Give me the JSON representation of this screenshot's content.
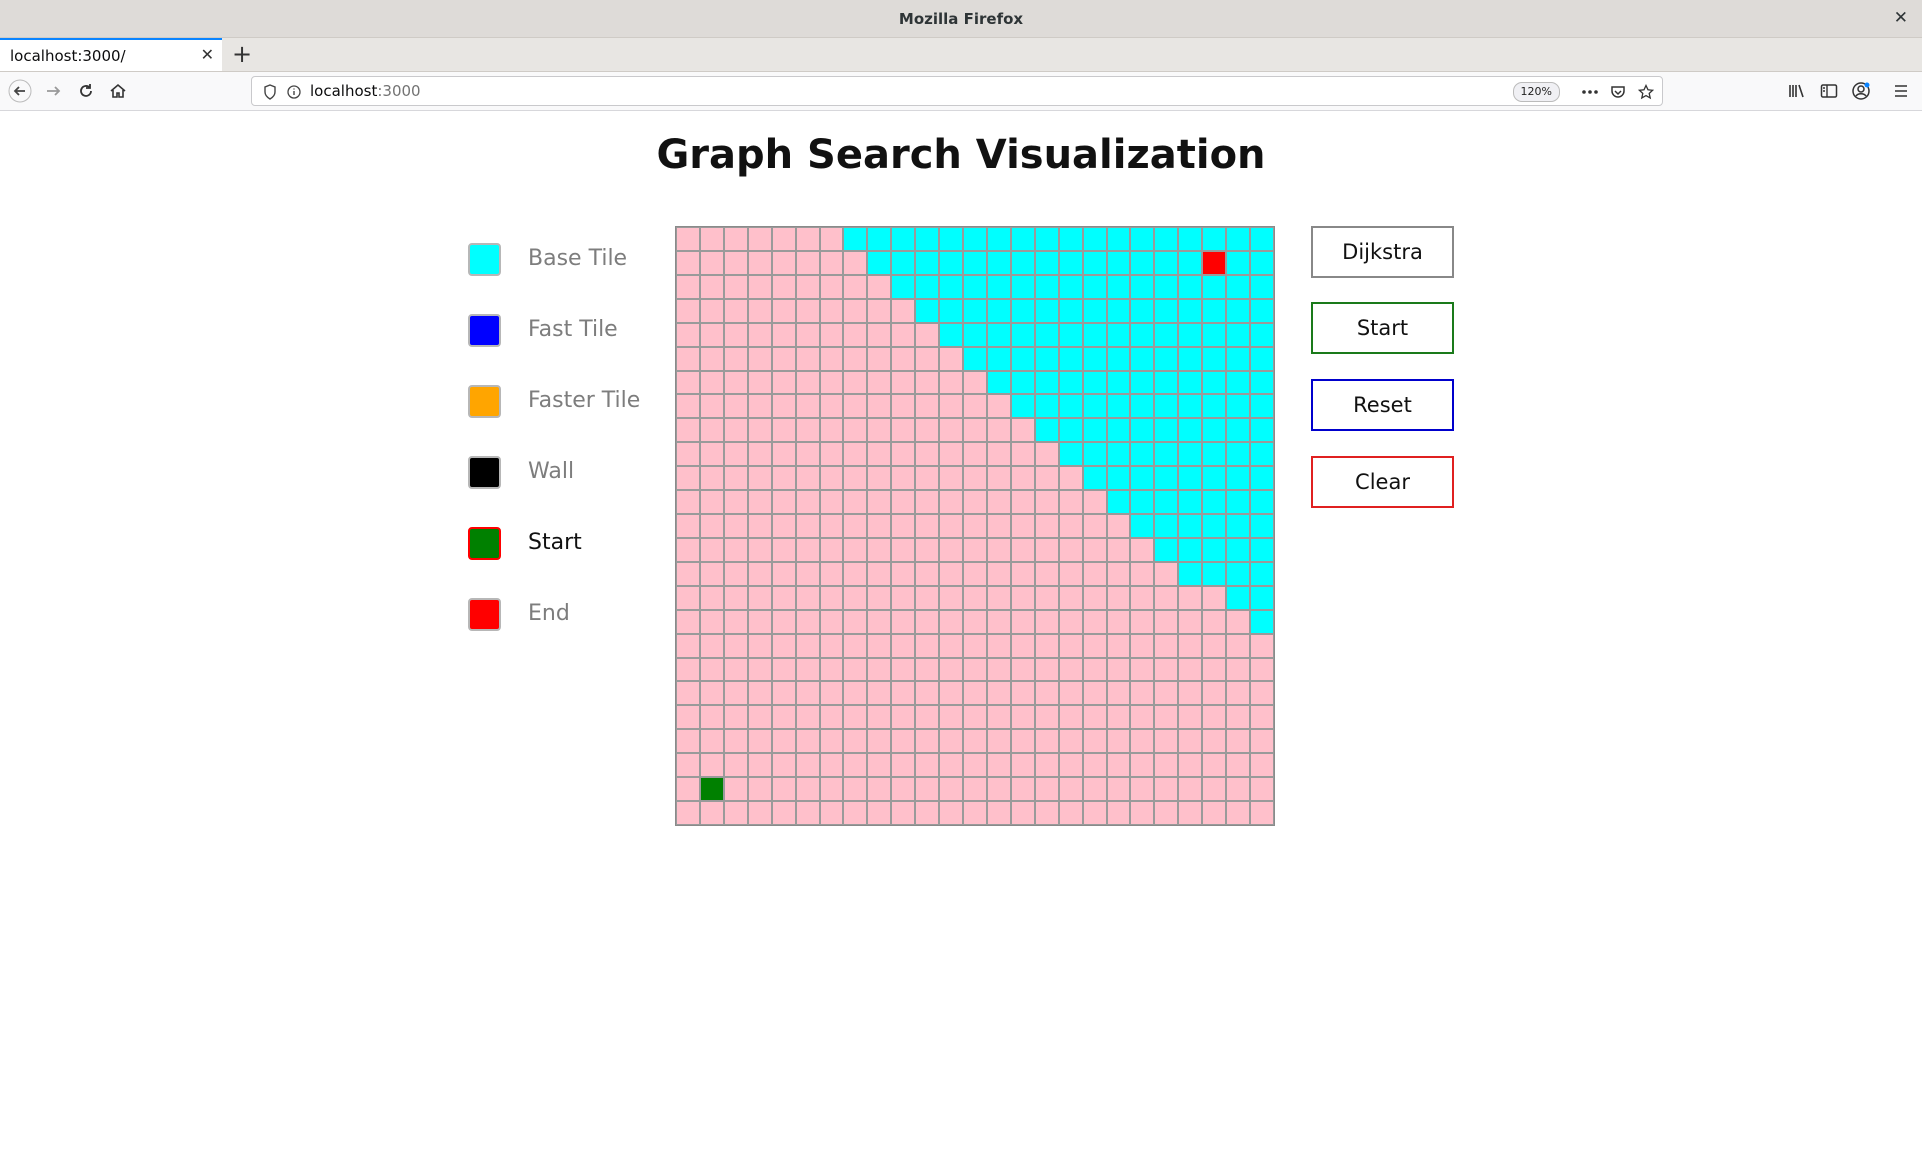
{
  "browser": {
    "window_title": "Mozilla Firefox",
    "tab_label": "localhost:3000/",
    "url_host": "localhost",
    "url_port": ":3000",
    "zoom": "120%"
  },
  "page": {
    "title": "Graph Search Visualization"
  },
  "legend": [
    {
      "label": "Base Tile",
      "color": "#00ffff",
      "selected": false
    },
    {
      "label": "Fast Tile",
      "color": "#0000ff",
      "selected": false
    },
    {
      "label": "Faster Tile",
      "color": "#ffa500",
      "selected": false
    },
    {
      "label": "Wall",
      "color": "#000000",
      "selected": false
    },
    {
      "label": "Start",
      "color": "#008000",
      "selected": true
    },
    {
      "label": "End",
      "color": "#ff0000",
      "selected": false
    }
  ],
  "controls": {
    "algorithm_label": "Dijkstra",
    "start_label": "Start",
    "reset_label": "Reset",
    "clear_label": "Clear",
    "algorithm_color": "#888888",
    "start_color": "#1a7a1a",
    "reset_color": "#0000cc",
    "clear_color": "#e02020"
  },
  "grid": {
    "rows": 25,
    "cols": 25,
    "unvisited_color": "#00ffff",
    "visited_color": "#ffc0cb",
    "start_color": "#008000",
    "end_color": "#ff0000",
    "start_cell": {
      "row": 23,
      "col": 1
    },
    "end_cell": {
      "row": 1,
      "col": 22
    },
    "visited_prefix_per_row": [
      7,
      8,
      9,
      10,
      11,
      12,
      13,
      14,
      15,
      16,
      17,
      18,
      19,
      20,
      21,
      23,
      24,
      25,
      25,
      25,
      25,
      25,
      25,
      25,
      25
    ]
  }
}
